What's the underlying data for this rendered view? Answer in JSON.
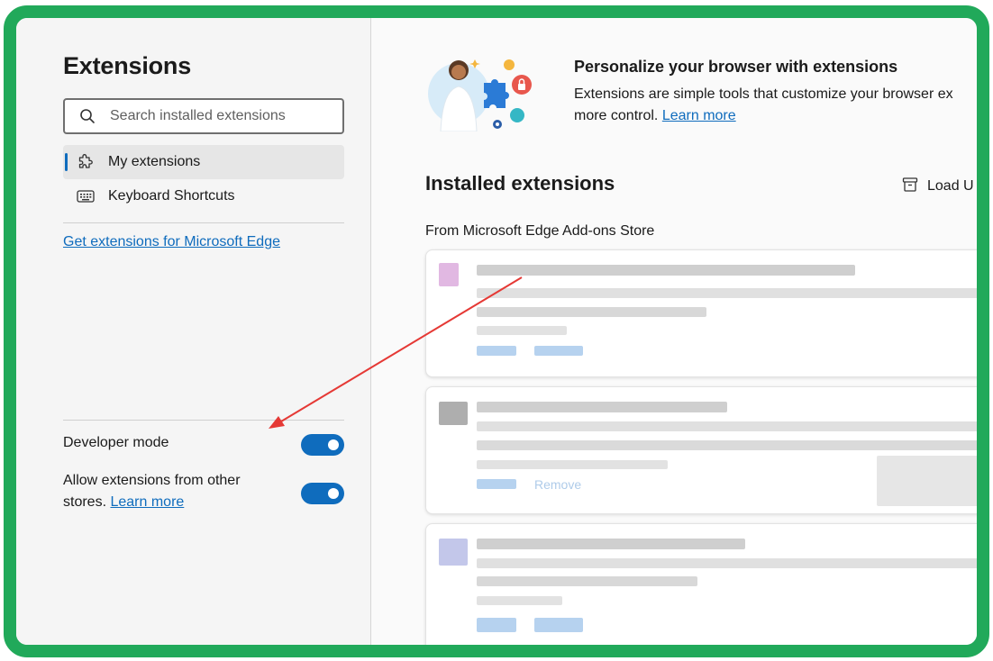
{
  "sidebar": {
    "title": "Extensions",
    "search": {
      "placeholder": "Search installed extensions"
    },
    "nav": [
      {
        "label": "My extensions",
        "icon": "puzzle-icon",
        "active": true
      },
      {
        "label": "Keyboard Shortcuts",
        "icon": "keyboard-icon",
        "active": false
      }
    ],
    "get_extensions_link": "Get extensions for Microsoft Edge",
    "developer_mode": {
      "label": "Developer mode",
      "enabled": true
    },
    "other_stores": {
      "label": "Allow extensions from other stores.",
      "link": "Learn more",
      "enabled": true
    }
  },
  "main": {
    "hero": {
      "title": "Personalize your browser with extensions",
      "description_line1": "Extensions are simple tools that customize your browser ex",
      "description_line2": "more control.",
      "learn_more": "Learn more"
    },
    "installed_title": "Installed extensions",
    "load_unpacked": "Load U",
    "store_label": "From Microsoft Edge Add-ons Store",
    "partial_card_text": "Remove"
  },
  "colors": {
    "frame_border": "#21a95a",
    "accent": "#0f6cbd",
    "annotation_arrow": "#e53935"
  }
}
